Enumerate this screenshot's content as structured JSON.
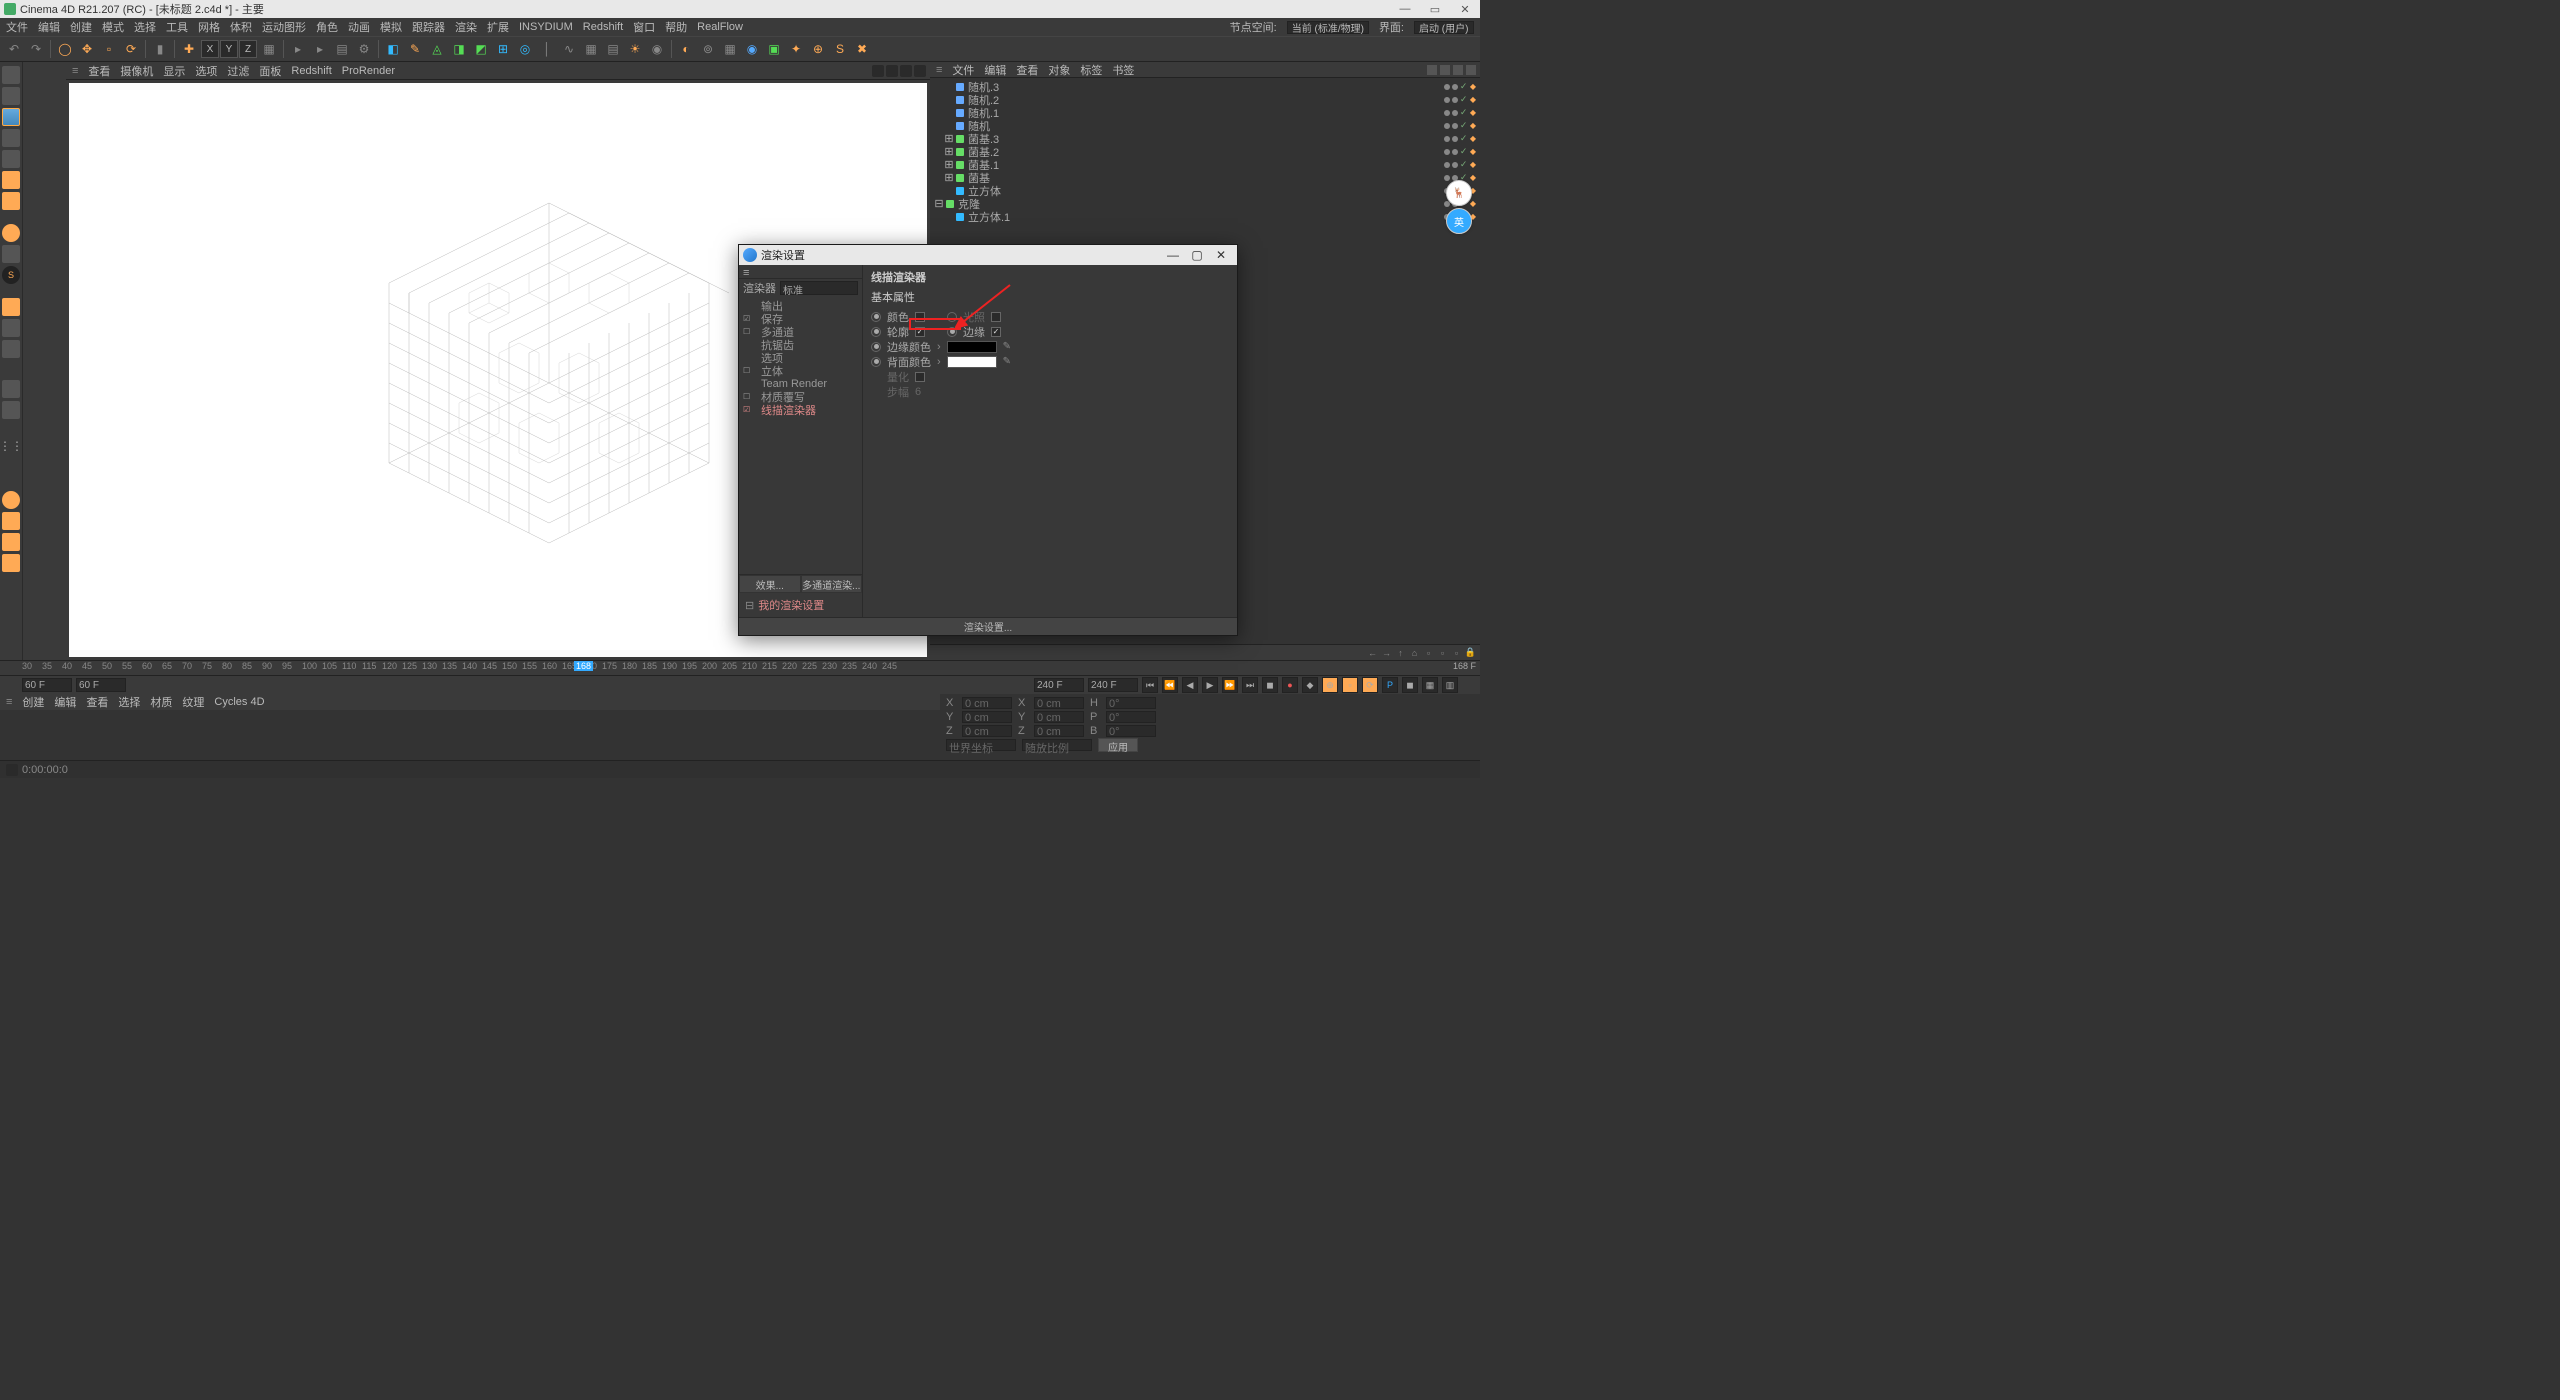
{
  "title": "Cinema 4D R21.207 (RC) - [未标题 2.c4d *] - 主要",
  "menubar": {
    "items": [
      "文件",
      "编辑",
      "创建",
      "模式",
      "选择",
      "工具",
      "网格",
      "体积",
      "运动图形",
      "角色",
      "动画",
      "模拟",
      "跟踪器",
      "渲染",
      "扩展",
      "INSYDIUM",
      "Redshift",
      "窗口",
      "帮助",
      "RealFlow"
    ],
    "right": {
      "label_ns": "节点空间:",
      "dd_ns": "当前 (标准/物理)",
      "label_lay": "界面:",
      "dd_lay": "启动 (用户)"
    }
  },
  "viewmenu": [
    "查看",
    "摄像机",
    "显示",
    "选项",
    "过滤",
    "面板",
    "Redshift",
    "ProRender"
  ],
  "objmenu": [
    "文件",
    "编辑",
    "查看",
    "对象",
    "标签",
    "书签"
  ],
  "objects": [
    {
      "name": "随机.3",
      "ico": "#6af",
      "indent": 1,
      "expand": ""
    },
    {
      "name": "随机.2",
      "ico": "#6af",
      "indent": 1,
      "expand": ""
    },
    {
      "name": "随机.1",
      "ico": "#6af",
      "indent": 1,
      "expand": ""
    },
    {
      "name": "随机",
      "ico": "#6af",
      "indent": 1,
      "expand": ""
    },
    {
      "name": "菌基.3",
      "ico": "#6d6",
      "indent": 1,
      "expand": "⊞"
    },
    {
      "name": "菌基.2",
      "ico": "#6d6",
      "indent": 1,
      "expand": "⊞"
    },
    {
      "name": "菌基.1",
      "ico": "#6d6",
      "indent": 1,
      "expand": "⊞"
    },
    {
      "name": "菌基",
      "ico": "#6d6",
      "indent": 1,
      "expand": "⊞"
    },
    {
      "name": "立方体",
      "ico": "#3bf",
      "indent": 1,
      "expand": ""
    },
    {
      "name": "克隆",
      "ico": "#6d6",
      "indent": 0,
      "expand": "⊟"
    },
    {
      "name": "立方体.1",
      "ico": "#3bf",
      "indent": 1,
      "expand": ""
    }
  ],
  "timeline": {
    "start": 30,
    "end": 248,
    "step": 5,
    "current": 168,
    "current_label": "168 F",
    "f1": "60 F",
    "f2": "60 F",
    "f3": "240 F",
    "f4": "240 F"
  },
  "matmenu": [
    "创建",
    "编辑",
    "查看",
    "选择",
    "材质",
    "纹理",
    "Cycles 4D"
  ],
  "coord": {
    "x": "0 cm",
    "y": "0 cm",
    "z": "0 cm",
    "xs": "0 cm",
    "ys": "0 cm",
    "zs": "0 cm",
    "h": "0°",
    "p": "0°",
    "b": "0°",
    "dd1": "世界坐标",
    "dd2": "随放比例",
    "apply": "应用",
    "lx": "X",
    "ly": "Y",
    "lz": "Z",
    "lh": "H",
    "lp": "P",
    "lb": "B"
  },
  "status": "0:00:00:0",
  "dialog": {
    "title": "渲染设置",
    "renderer_label": "渲染器",
    "renderer": "标准",
    "items": [
      {
        "label": "输出",
        "chk": ""
      },
      {
        "label": "保存",
        "chk": "☑"
      },
      {
        "label": "多通道",
        "chk": "☐"
      },
      {
        "label": "抗锯齿",
        "chk": ""
      },
      {
        "label": "选项",
        "chk": ""
      },
      {
        "label": "立体",
        "chk": "☐"
      },
      {
        "label": "Team Render",
        "chk": ""
      },
      {
        "label": "材质覆写",
        "chk": "☐"
      },
      {
        "label": "线描渲染器",
        "chk": "☑",
        "active": true
      }
    ],
    "btn_effect": "效果...",
    "btn_multi": "多通道渲染...",
    "mysettings": "我的渲染设置",
    "panel_title": "线描渲染器",
    "basic_title": "基本属性",
    "p_color": "颜色",
    "p_light": "光照",
    "p_outline": "轮廓",
    "p_edge": "边缘",
    "p_edgecolor": "边缘颜色",
    "p_bgcolor": "背面颜色",
    "p_quant": "量化",
    "p_step": "步幅",
    "step_val": "6",
    "color_edge": "#000",
    "color_bg": "#fff",
    "footer_btn": "渲染设置..."
  },
  "floatlabel": "英"
}
